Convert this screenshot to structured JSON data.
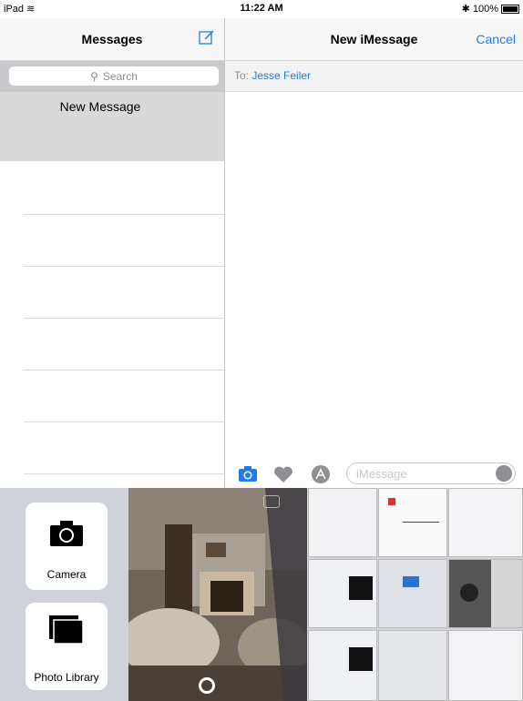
{
  "status": {
    "device": "iPad",
    "time": "11:22 AM",
    "battery": "100%"
  },
  "sidebar": {
    "title": "Messages",
    "search_placeholder": "Search",
    "selected_item": "New Message"
  },
  "conversation": {
    "title": "New iMessage",
    "cancel_label": "Cancel",
    "to_label": "To:",
    "recipient": "Jesse Feiler",
    "message_placeholder": "iMessage"
  },
  "tray": {
    "camera_label": "Camera",
    "photo_library_label": "Photo Library"
  },
  "colors": {
    "accent": "#1e7cf2"
  }
}
